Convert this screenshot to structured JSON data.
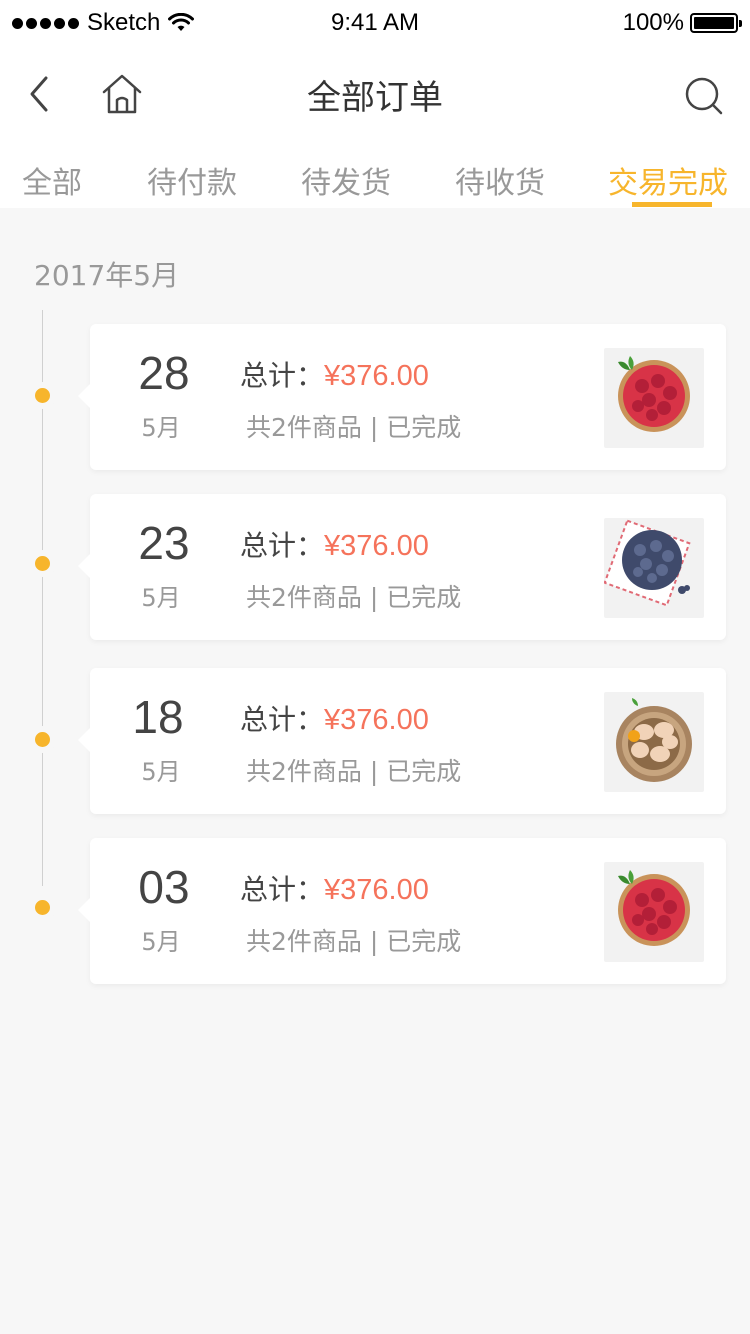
{
  "status_bar": {
    "carrier": "Sketch",
    "time": "9:41 AM",
    "battery": "100%"
  },
  "header": {
    "title": "全部订单"
  },
  "tabs": [
    {
      "label": "全部",
      "active": false
    },
    {
      "label": "待付款",
      "active": false
    },
    {
      "label": "待发货",
      "active": false
    },
    {
      "label": "待收货",
      "active": false
    },
    {
      "label": "交易完成",
      "active": true
    }
  ],
  "section_month": "2017年5月",
  "orders": [
    {
      "day": "28",
      "month": "5月",
      "total_label": "总计：",
      "price": "¥376.00",
      "meta": "共2件商品 | 已完成",
      "image": "raspberry-bowl"
    },
    {
      "day": "23",
      "month": "5月",
      "total_label": "总计：",
      "price": "¥376.00",
      "meta": "共2件商品 | 已完成",
      "image": "blueberry-plate"
    },
    {
      "day": "18",
      "month": "5月",
      "total_label": "总计：",
      "price": "¥376.00",
      "meta": "共2件商品 | 已完成",
      "image": "egg-nest"
    },
    {
      "day": "03",
      "month": "5月",
      "total_label": "总计：",
      "price": "¥376.00",
      "meta": "共2件商品 | 已完成",
      "image": "raspberry-bowl"
    }
  ],
  "colors": {
    "accent": "#f7b52c",
    "price": "#f5735b",
    "background": "#f7f7f7"
  }
}
